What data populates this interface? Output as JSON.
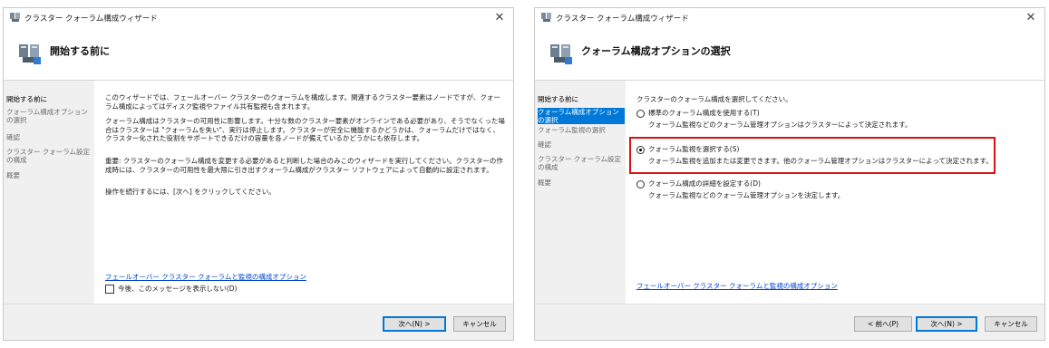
{
  "window1": {
    "title": "クラスター クォーラム構成ウィザード",
    "heading": "開始する前に",
    "nav": [
      "開始する前に",
      "クォーラム構成オプションの選択",
      "確認",
      "クラスター クォーラム設定の構成",
      "概要"
    ],
    "paragraphs": [
      "このウィザードでは、フェールオーバー クラスターのクォーラムを構成します。関連するクラスター要素はノードですが、クォーラム構成によってはディスク監視やファイル共有監視も含まれます。",
      "クォーラム構成はクラスターの可用性に影響します。十分な数のクラスター要素がオンラインである必要があり、そうでなくった場合はクラスターは \"クォーラムを失い\"、実行は停止します。クラスターが完全に機能するかどうかは、クォーラムだけではなく、クラスター化された役割をサポートできるだけの容量を各ノードが備えているかどうかにも依存します。",
      "重要: クラスターのクォーラム構成を変更する必要があると判断した場合のみこのウィザードを実行してください。クラスターの作成時には、クラスターの可用性を最大限に引き出すクォーラム構成がクラスター ソフトウェアによって自動的に設定されます。",
      "操作を続行するには、[次へ] をクリックしてください。"
    ],
    "link": "フェールオーバー クラスター クォーラムと監視の構成オプション",
    "checkbox_label": "今後、このメッセージを表示しない(D)",
    "checkbox_checked": false,
    "buttons": {
      "next": "次へ(N) >",
      "cancel": "キャンセル"
    }
  },
  "window2": {
    "title": "クラスター クォーラム構成ウィザード",
    "heading": "クォーラム構成オプションの選択",
    "nav": [
      "開始する前に",
      "クォーラム構成オプションの選択",
      "クォーラム監視の選択",
      "確認",
      "クラスター クォーラム設定の構成",
      "概要"
    ],
    "current_nav_index": 1,
    "prompt": "クラスターのクォーラム構成を選択してください。",
    "options": [
      {
        "label": "標準のクォーラム構成を使用する(T)",
        "desc": "クォーラム監視などのクォーラム管理オプションはクラスターによって決定されます。",
        "selected": false
      },
      {
        "label": "クォーラム監視を選択する(S)",
        "desc": "クォーラム監視を追加または変更できます。他のクォーラム管理オプションはクラスターによって決定されます。",
        "selected": true
      },
      {
        "label": "クォーラム構成の詳細を設定する(D)",
        "desc": "クォーラム監視などのクォーラム管理オプションを決定します。",
        "selected": false
      }
    ],
    "link": "フェールオーバー クラスター クォーラムと監視の構成オプション",
    "buttons": {
      "prev": "< 前へ(P)",
      "next": "次へ(N) >",
      "cancel": "キャンセル"
    }
  },
  "colors": {
    "highlight": "#e01010",
    "link": "#0044cc",
    "nav_current": "#0078d7"
  }
}
